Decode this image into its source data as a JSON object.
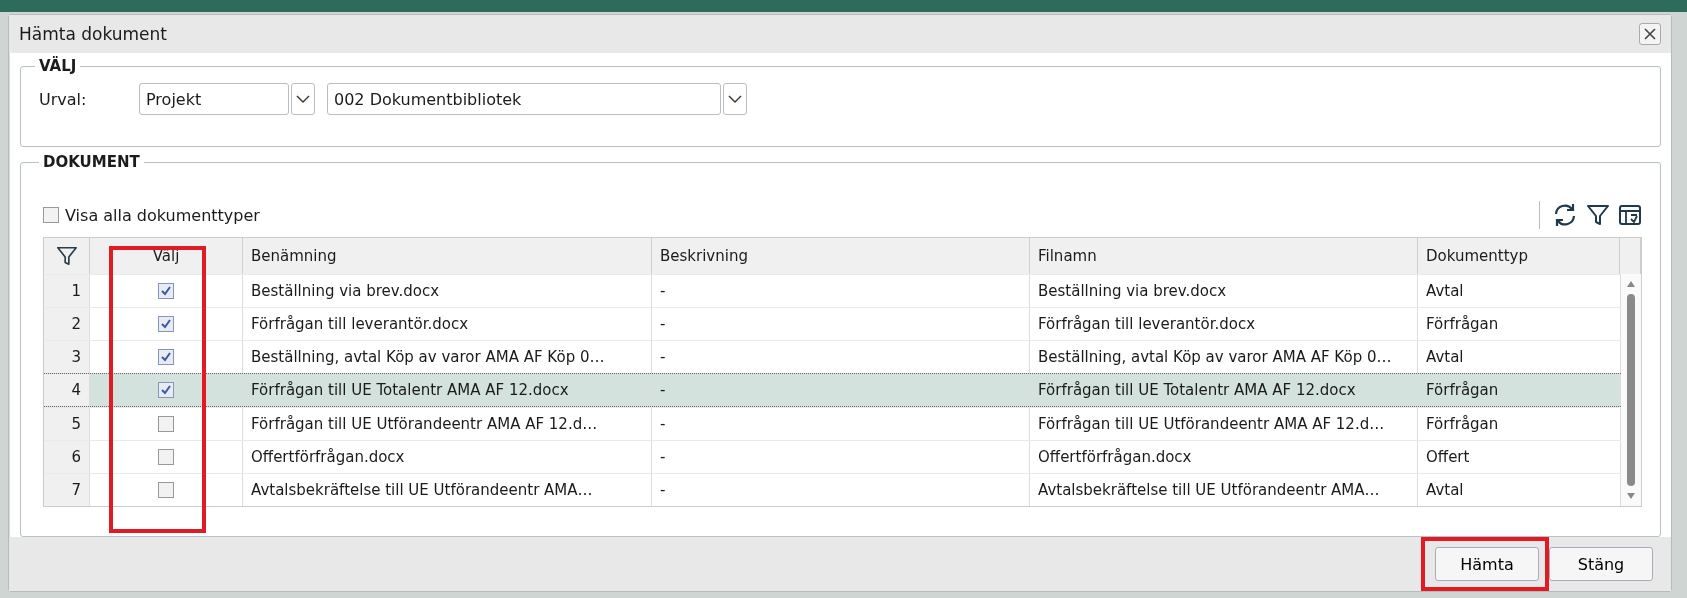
{
  "window": {
    "title": "Hämta dokument"
  },
  "selection": {
    "legend": "VÄLJ",
    "label": "Urval:",
    "scope": {
      "value": "Projekt"
    },
    "library": {
      "value": "002 Dokumentbibliotek"
    }
  },
  "documents": {
    "legend": "DOKUMENT",
    "show_all_types": {
      "label": "Visa alla dokumenttyper",
      "checked": false
    },
    "table": {
      "columns": [
        "Välj",
        "Benämning",
        "Beskrivning",
        "Filnamn",
        "Dokumenttyp"
      ],
      "rows": [
        {
          "number": "1",
          "checked": true,
          "selected": false,
          "name": "Beställning via brev.docx",
          "description": "-",
          "filename": "Beställning via brev.docx",
          "type": "Avtal"
        },
        {
          "number": "2",
          "checked": true,
          "selected": false,
          "name": "Förfrågan till leverantör.docx",
          "description": "-",
          "filename": "Förfrågan till leverantör.docx",
          "type": "Förfrågan"
        },
        {
          "number": "3",
          "checked": true,
          "selected": false,
          "name": "Beställning, avtal Köp av varor AMA AF Köp 0…",
          "description": "-",
          "filename": "Beställning, avtal Köp av varor AMA AF Köp 0…",
          "type": "Avtal"
        },
        {
          "number": "4",
          "checked": true,
          "selected": true,
          "name": "Förfrågan till UE Totalentr AMA AF 12.docx",
          "description": "-",
          "filename": "Förfrågan till UE Totalentr AMA AF 12.docx",
          "type": "Förfrågan"
        },
        {
          "number": "5",
          "checked": false,
          "selected": false,
          "name": "Förfrågan till UE Utförandeentr AMA AF 12.d…",
          "description": "-",
          "filename": "Förfrågan till UE Utförandeentr AMA AF 12.d…",
          "type": "Förfrågan"
        },
        {
          "number": "6",
          "checked": false,
          "selected": false,
          "name": "Offertförfrågan.docx",
          "description": "-",
          "filename": "Offertförfrågan.docx",
          "type": "Offert"
        },
        {
          "number": "7",
          "checked": false,
          "selected": false,
          "name": "Avtalsbekräftelse till UE Utförandeentr AMA…",
          "description": "-",
          "filename": "Avtalsbekräftelse till UE Utförandeentr AMA…",
          "type": "Avtal"
        }
      ]
    }
  },
  "buttons": [
    {
      "label": "Hämta"
    },
    {
      "label": "Stäng"
    }
  ]
}
